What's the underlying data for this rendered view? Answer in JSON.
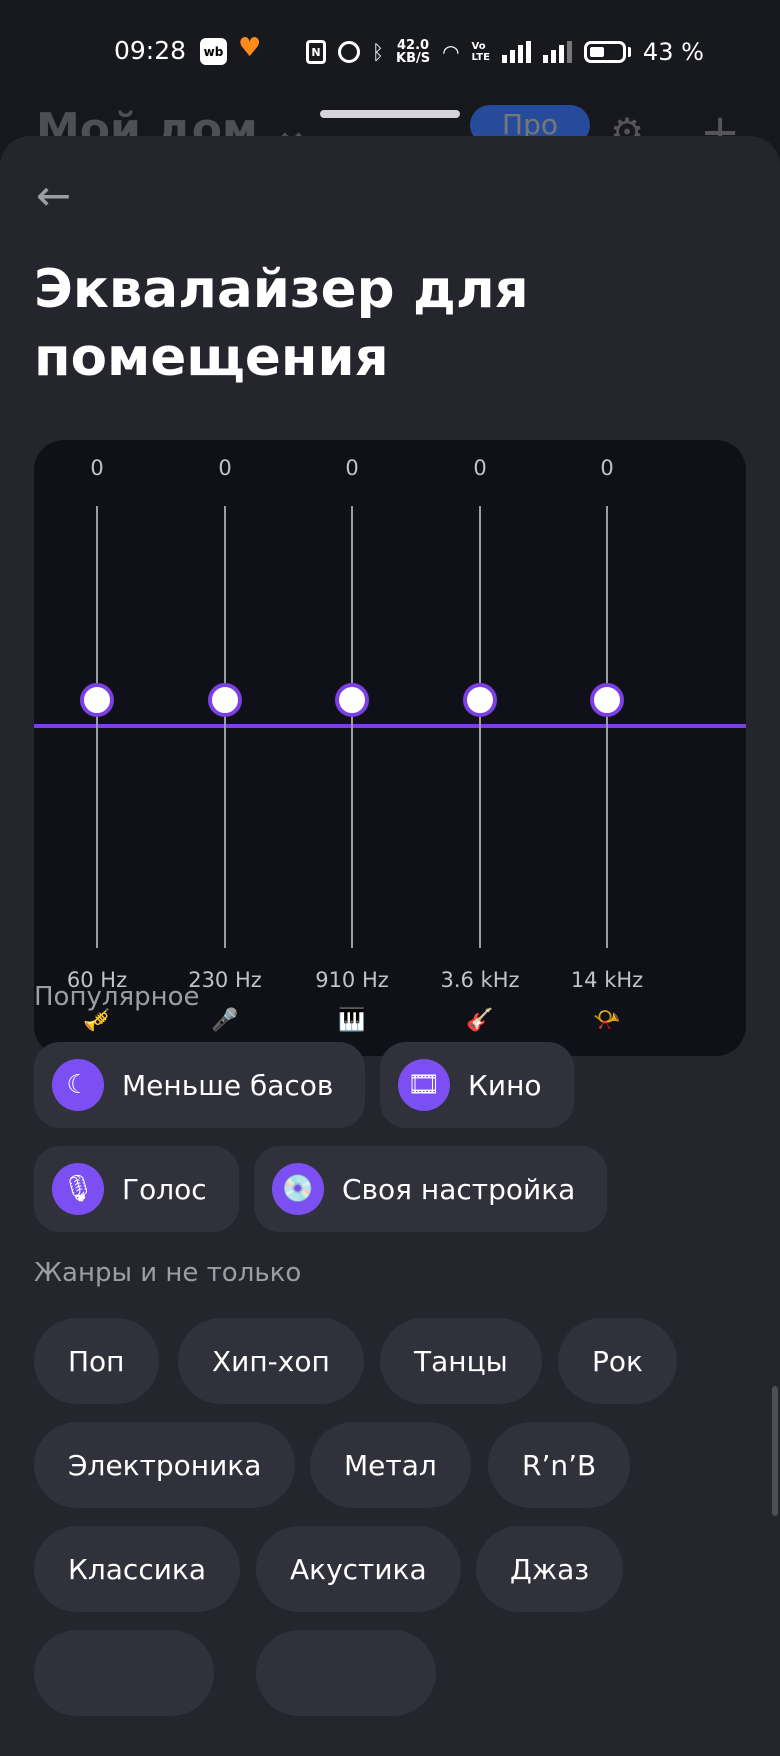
{
  "status": {
    "time": "09:28",
    "wb": "wb",
    "heart_icon": "heart-icon",
    "nfc": "N",
    "speed_value": "42.0",
    "speed_unit": "KB/S",
    "volte_top": "Vo",
    "volte_bottom": "LTE",
    "battery": "43 %"
  },
  "background": {
    "title": "Мой дом ⌄",
    "pill": "Про"
  },
  "back_icon": "arrow-left-icon",
  "page_title": "Эквалайзер для помещения",
  "equalizer": {
    "accent_color": "#7b3fe4",
    "bands": [
      {
        "value": "0",
        "label": "60 Hz",
        "icon": "🎺",
        "icon_name": "trumpet-icon"
      },
      {
        "value": "0",
        "label": "230 Hz",
        "icon": "🎤",
        "icon_name": "microphone-icon"
      },
      {
        "value": "0",
        "label": "910 Hz",
        "icon": "🎹",
        "icon_name": "piano-icon"
      },
      {
        "value": "0",
        "label": "3.6 kHz",
        "icon": "🎸",
        "icon_name": "guitar-icon"
      },
      {
        "value": "0",
        "label": "14 kHz",
        "icon": "📯",
        "icon_name": "whistle-icon"
      }
    ]
  },
  "popular": {
    "heading": "Популярное",
    "presets": [
      {
        "label": "Меньше басов",
        "icon": "☾",
        "icon_name": "moon-icon"
      },
      {
        "label": "Кино",
        "icon": "🎞",
        "icon_name": "film-icon"
      },
      {
        "label": "Голос",
        "icon": "🎙",
        "icon_name": "microphone-icon"
      },
      {
        "label": "Своя настройка",
        "icon": "💿",
        "icon_name": "disc-icon"
      }
    ]
  },
  "genres": {
    "heading": "Жанры и не только",
    "items": [
      "Поп",
      "Хип-хоп",
      "Танцы",
      "Рок",
      "Электроника",
      "Метал",
      "R’n’B",
      "Классика",
      "Акустика",
      "Джаз"
    ]
  }
}
